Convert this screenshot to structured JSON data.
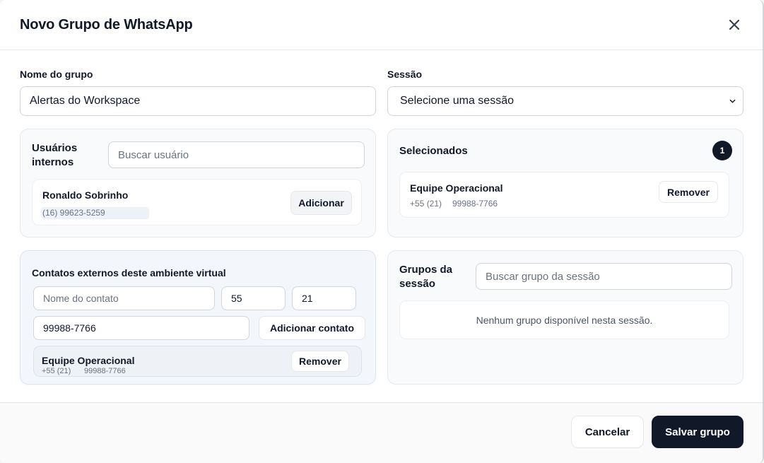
{
  "modal": {
    "title": "Novo Grupo de WhatsApp",
    "close_icon": "close-icon"
  },
  "group_name": {
    "label": "Nome do grupo",
    "value": "Alertas do Workspace"
  },
  "session": {
    "label": "Sessão",
    "selected": "Selecione uma sessão"
  },
  "internal_users": {
    "title_line1": "Usuários",
    "title_line2": "internos",
    "search_placeholder": "Buscar usuário",
    "items": [
      {
        "name": "Ronaldo Sobrinho",
        "phone": "(16) 99623-5259",
        "action": "Adicionar"
      }
    ]
  },
  "selected": {
    "title": "Selecionados",
    "count": "1",
    "items": [
      {
        "name": "Equipe Operacional",
        "ddi_ddd": "+55 (21)",
        "number": "99988-7766",
        "action": "Remover"
      }
    ]
  },
  "external_contacts": {
    "title": "Contatos externos deste ambiente virtual",
    "name_placeholder": "Nome do contato",
    "ddi_value": "55",
    "ddd_value": "21",
    "number_value": "99988-7766",
    "add_label": "Adicionar contato",
    "items": [
      {
        "name": "Equipe Operacional",
        "ddi_ddd": "+55 (21)",
        "number": "99988-7766",
        "action": "Remover"
      }
    ]
  },
  "session_groups": {
    "title_line1": "Grupos da",
    "title_line2": "sessão",
    "search_placeholder": "Buscar grupo da sessão",
    "empty": "Nenhum grupo disponível nesta sessão."
  },
  "footer": {
    "cancel": "Cancelar",
    "save": "Salvar grupo"
  },
  "colors": {
    "primary": "#111827",
    "panel_bg": "#f9fafb",
    "border": "#e5e7eb"
  }
}
